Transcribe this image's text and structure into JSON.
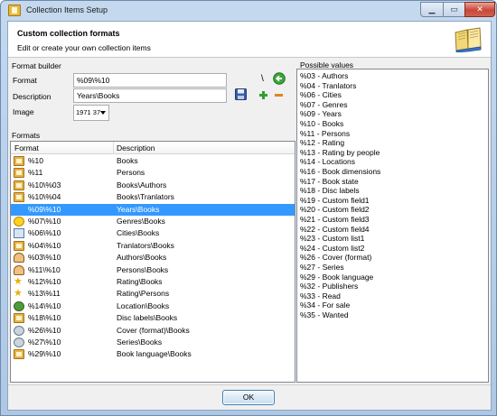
{
  "window": {
    "title": "Collection Items Setup",
    "min_label": "▁",
    "max_label": "▭",
    "close_label": "✕"
  },
  "header": {
    "title": "Custom collection formats",
    "subtitle": "Edit or create your own collection items"
  },
  "format_builder": {
    "group_label": "Format builder",
    "format_label": "Format",
    "format_value": "%09\\%10",
    "description_label": "Description",
    "description_value": "Years\\Books",
    "image_label": "Image",
    "image_value": "1971 37",
    "backslash_label": "\\"
  },
  "formats": {
    "label": "Formats",
    "col_format": "Format",
    "col_description": "Description",
    "rows": [
      {
        "format": "%10",
        "description": "Books",
        "icon": "book-icon"
      },
      {
        "format": "%11",
        "description": "Persons",
        "icon": "book-icon"
      },
      {
        "format": "%10\\%03",
        "description": "Books\\Authors",
        "icon": "book-icon"
      },
      {
        "format": "%10\\%04",
        "description": "Books\\Tranlators",
        "icon": "book-icon"
      },
      {
        "format": "%09\\%10",
        "description": "Years\\Books",
        "icon": "year-icon",
        "selected": true
      },
      {
        "format": "%07\\%10",
        "description": "Genres\\Books",
        "icon": "smiley-icon"
      },
      {
        "format": "%06\\%10",
        "description": "Cities\\Books",
        "icon": "document-icon"
      },
      {
        "format": "%04\\%10",
        "description": "Tranlators\\Books",
        "icon": "book-icon"
      },
      {
        "format": "%03\\%10",
        "description": "Authors\\Books",
        "icon": "person-icon"
      },
      {
        "format": "%11\\%10",
        "description": "Persons\\Books",
        "icon": "person-icon"
      },
      {
        "format": "%12\\%10",
        "description": "Rating\\Books",
        "icon": "star-icon"
      },
      {
        "format": "%13\\%11",
        "description": "Rating\\Persons",
        "icon": "star-icon"
      },
      {
        "format": "%14\\%10",
        "description": "Location\\Books",
        "icon": "globe-icon"
      },
      {
        "format": "%18\\%10",
        "description": "Disc labels\\Books",
        "icon": "book-icon"
      },
      {
        "format": "%26\\%10",
        "description": "Cover (format)\\Books",
        "icon": "disc-icon"
      },
      {
        "format": "%27\\%10",
        "description": "Series\\Books",
        "icon": "disc-icon"
      },
      {
        "format": "%29\\%10",
        "description": "Book language\\Books",
        "icon": "book-icon"
      }
    ]
  },
  "possible_values": {
    "label": "Possible values",
    "items": [
      "%03 - Authors",
      "%04 - Tranlators",
      "%06 - Cities",
      "%07 - Genres",
      "%09 - Years",
      "%10 - Books",
      "%11 - Persons",
      "%12 - Rating",
      "%13 - Rating by people",
      "%14 - Locations",
      "%16 - Book dimensions",
      "%17 - Book state",
      "%18 - Disc labels",
      "%19 - Custom field1",
      "%20 - Custom field2",
      "%21 - Custom field3",
      "%22 - Custom field4",
      "%23 - Custom list1",
      "%24 - Custom list2",
      "%26 - Cover (format)",
      "%27 - Series",
      "%29 - Book language",
      "%32 - Publishers",
      "%33 - Read",
      "%34 - For sale",
      "%35 - Wanted"
    ]
  },
  "footer": {
    "ok_label": "OK"
  },
  "colors": {
    "selection": "#3399ff",
    "title_bar": "#b9d1ea",
    "close_button": "#c8483a"
  }
}
